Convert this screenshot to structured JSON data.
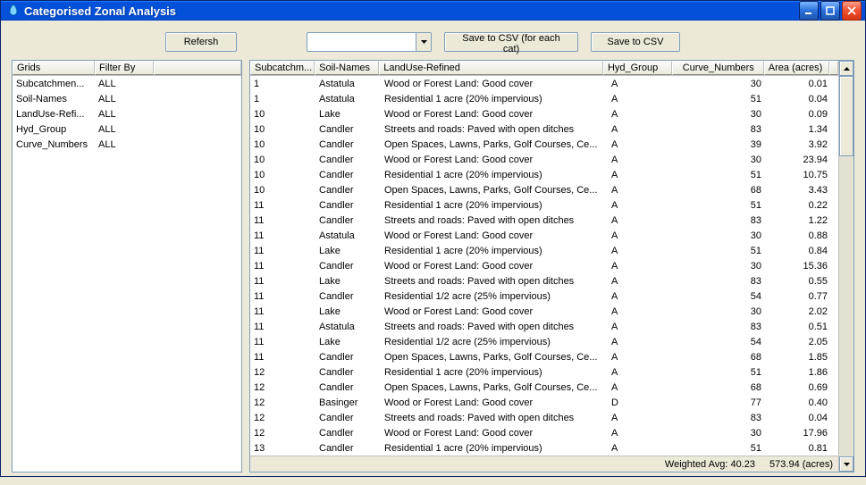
{
  "window": {
    "title": "Categorised Zonal Analysis"
  },
  "toolbar": {
    "refresh": "Refersh",
    "combo_value": "",
    "save_each": "Save to CSV (for each cat)",
    "save_csv": "Save to CSV"
  },
  "left_headers": [
    "Grids",
    "Filter By",
    ""
  ],
  "left_rows": [
    [
      "Subcatchmen...",
      "ALL"
    ],
    [
      "Soil-Names",
      "ALL"
    ],
    [
      "LandUse-Refi...",
      "ALL"
    ],
    [
      "Hyd_Group",
      "ALL"
    ],
    [
      "Curve_Numbers",
      "ALL"
    ]
  ],
  "main_headers": [
    "Subcatchm...",
    "Soil-Names",
    "LandUse-Refined",
    "Hyd_Group",
    "Curve_Numbers",
    "Area (acres)"
  ],
  "main_rows": [
    [
      "1",
      "Astatula",
      "Wood or Forest Land: Good cover",
      "A",
      "30",
      "0.01"
    ],
    [
      "1",
      "Astatula",
      "Residential 1 acre (20% impervious)",
      "A",
      "51",
      "0.04"
    ],
    [
      "10",
      "Lake",
      "Wood or Forest Land: Good cover",
      "A",
      "30",
      "0.09"
    ],
    [
      "10",
      "Candler",
      "Streets and roads: Paved with open ditches",
      "A",
      "83",
      "1.34"
    ],
    [
      "10",
      "Candler",
      "Open Spaces, Lawns, Parks, Golf Courses, Ce...",
      "A",
      "39",
      "3.92"
    ],
    [
      "10",
      "Candler",
      "Wood or Forest Land: Good cover",
      "A",
      "30",
      "23.94"
    ],
    [
      "10",
      "Candler",
      "Residential 1 acre (20% impervious)",
      "A",
      "51",
      "10.75"
    ],
    [
      "10",
      "Candler",
      "Open Spaces, Lawns, Parks, Golf Courses, Ce...",
      "A",
      "68",
      "3.43"
    ],
    [
      "11",
      "Candler",
      "Residential 1 acre (20% impervious)",
      "A",
      "51",
      "0.22"
    ],
    [
      "11",
      "Candler",
      "Streets and roads: Paved with open ditches",
      "A",
      "83",
      "1.22"
    ],
    [
      "11",
      "Astatula",
      "Wood or Forest Land: Good cover",
      "A",
      "30",
      "0.88"
    ],
    [
      "11",
      "Lake",
      "Residential 1 acre (20% impervious)",
      "A",
      "51",
      "0.84"
    ],
    [
      "11",
      "Candler",
      "Wood or Forest Land: Good cover",
      "A",
      "30",
      "15.36"
    ],
    [
      "11",
      "Lake",
      "Streets and roads: Paved with open ditches",
      "A",
      "83",
      "0.55"
    ],
    [
      "11",
      "Candler",
      "Residential 1/2 acre (25% impervious)",
      "A",
      "54",
      "0.77"
    ],
    [
      "11",
      "Lake",
      "Wood or Forest Land: Good cover",
      "A",
      "30",
      "2.02"
    ],
    [
      "11",
      "Astatula",
      "Streets and roads: Paved with open ditches",
      "A",
      "83",
      "0.51"
    ],
    [
      "11",
      "Lake",
      "Residential 1/2 acre (25% impervious)",
      "A",
      "54",
      "2.05"
    ],
    [
      "11",
      "Candler",
      "Open Spaces, Lawns, Parks, Golf Courses, Ce...",
      "A",
      "68",
      "1.85"
    ],
    [
      "12",
      "Candler",
      "Residential 1 acre (20% impervious)",
      "A",
      "51",
      "1.86"
    ],
    [
      "12",
      "Candler",
      "Open Spaces, Lawns, Parks, Golf Courses, Ce...",
      "A",
      "68",
      "0.69"
    ],
    [
      "12",
      "Basinger",
      "Wood or Forest Land: Good cover",
      "D",
      "77",
      "0.40"
    ],
    [
      "12",
      "Candler",
      "Streets and roads: Paved with open ditches",
      "A",
      "83",
      "0.04"
    ],
    [
      "12",
      "Candler",
      "Wood or Forest Land: Good cover",
      "A",
      "30",
      "17.96"
    ],
    [
      "13",
      "Candler",
      "Residential 1 acre (20% impervious)",
      "A",
      "51",
      "0.81"
    ]
  ],
  "status": {
    "weighted_avg_label": "Weighted Avg:",
    "weighted_avg_value": "40.23",
    "area_value": "573.94",
    "area_unit": "(acres)"
  }
}
